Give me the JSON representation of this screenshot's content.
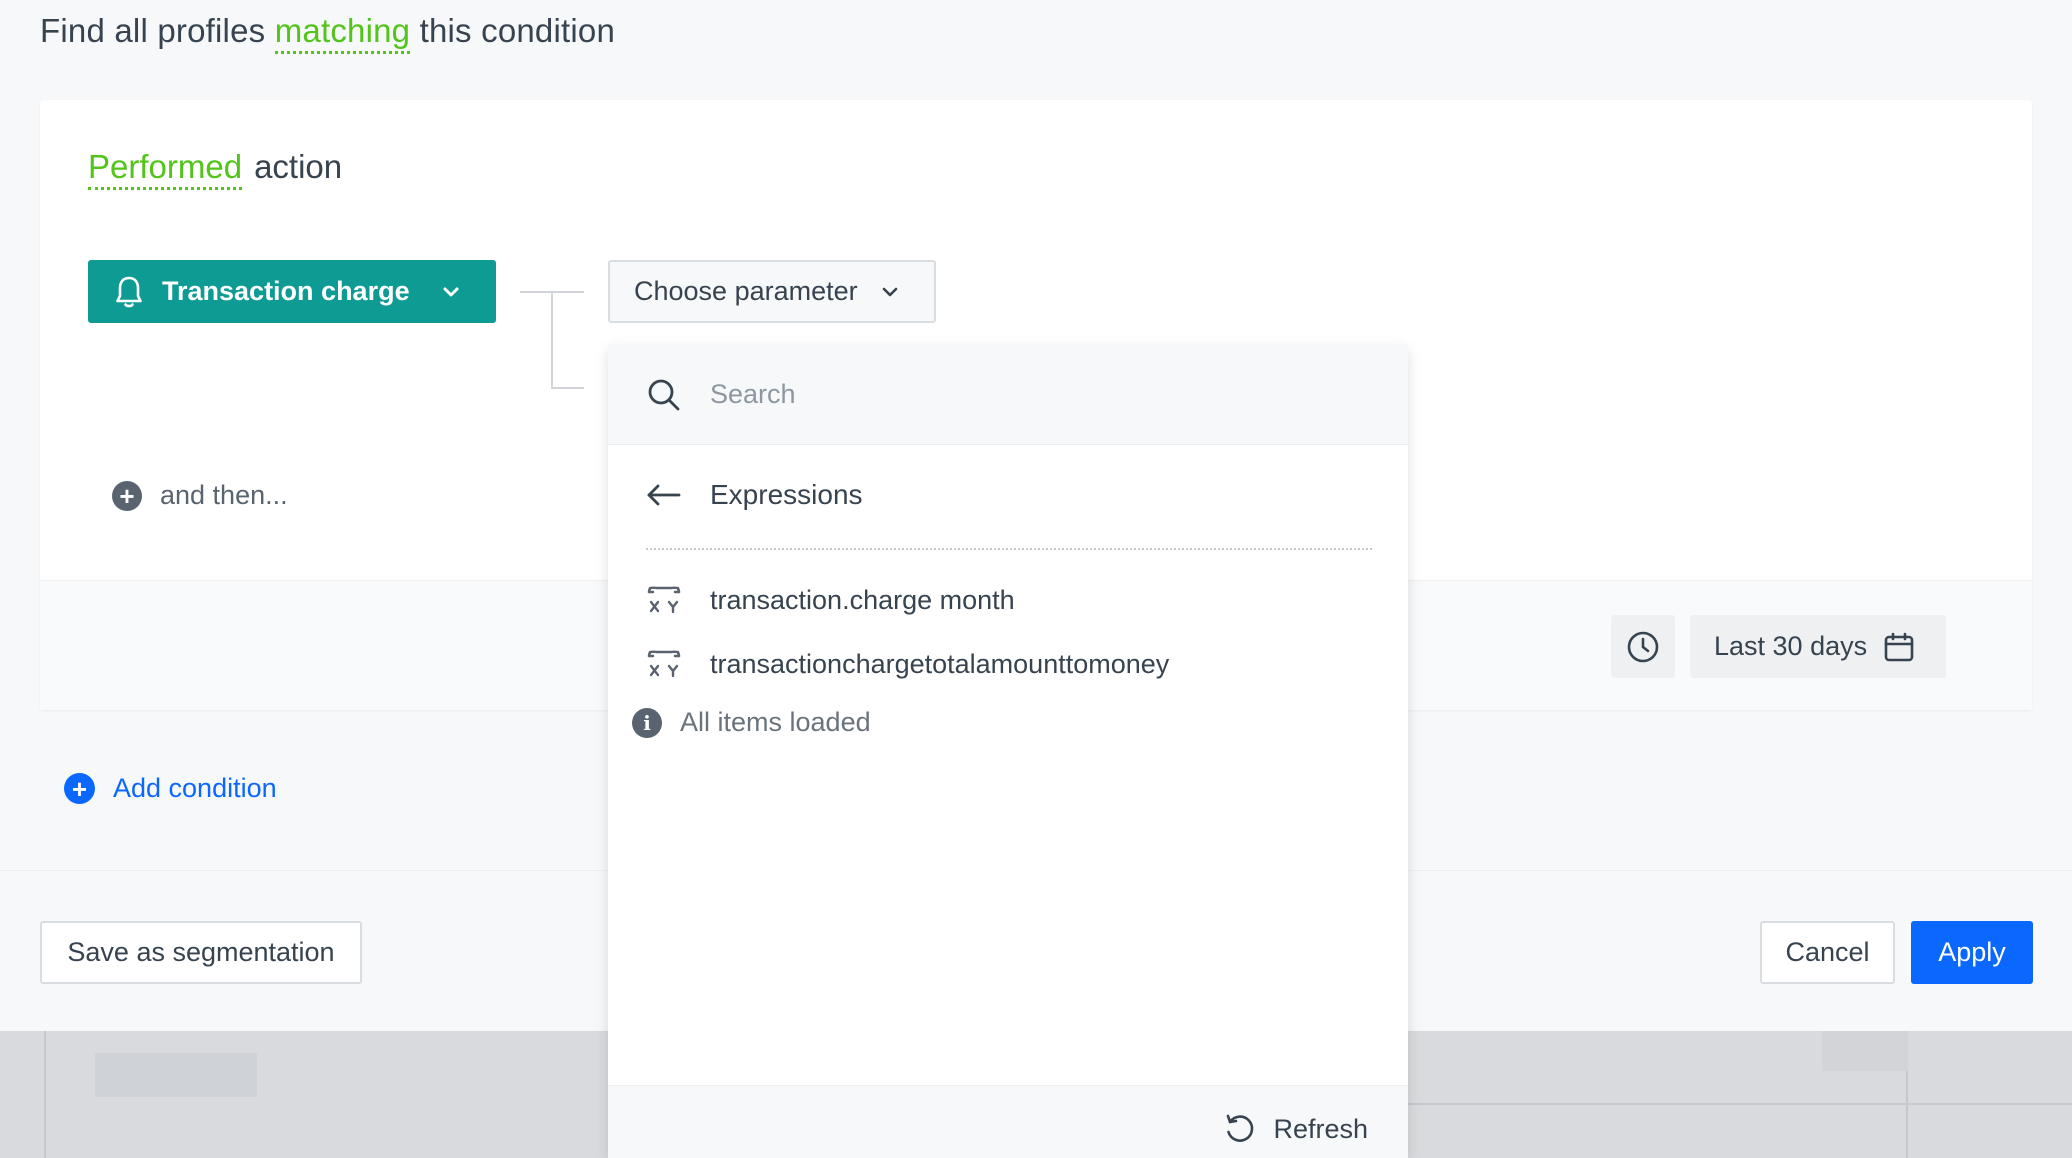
{
  "header": {
    "prefix": "Find all profiles",
    "match_mode": "matching",
    "suffix": "this condition"
  },
  "condition": {
    "mode": "Performed",
    "type": "action",
    "event_label": "Transaction charge",
    "event_icon": "bell-icon",
    "parameter_label": "Choose parameter",
    "and_then_label": "and then..."
  },
  "time_range": {
    "label": "Last 30 days"
  },
  "add_condition_label": "Add condition",
  "footer": {
    "save_label": "Save as segmentation",
    "cancel_label": "Cancel",
    "apply_label": "Apply"
  },
  "dropdown": {
    "search_placeholder": "Search",
    "back_label": "Expressions",
    "items": [
      {
        "label": "transaction.charge month",
        "icon": "expression-xy-icon"
      },
      {
        "label": "transactionchargetotalamounttomoney",
        "icon": "expression-xy-icon"
      }
    ],
    "status": "All items loaded",
    "refresh_label": "Refresh"
  },
  "colors": {
    "accent_green": "#52c41a",
    "event_teal": "#0d9b94",
    "primary_blue": "#0b68ff",
    "text": "#384350"
  }
}
